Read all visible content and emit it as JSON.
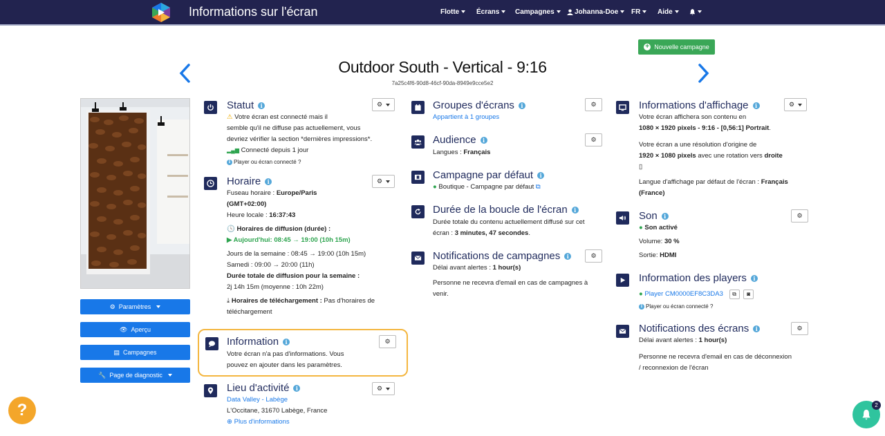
{
  "app": {
    "title": "Informations sur l'écran"
  },
  "nav": {
    "fleet": "Flotte",
    "screens": "Écrans",
    "campaigns": "Campagnes",
    "user": "Johanna-Doe",
    "lang": "FR",
    "help": "Aide"
  },
  "new_campaign": "Nouvelle campagne",
  "screen": {
    "name": "Outdoor South - Vertical - 9:16",
    "uuid": "7a25c4f6-90d8-46cf-90da-8949e9cce5e2"
  },
  "sidebar": {
    "settings": "Paramètres",
    "preview": "Aperçu",
    "campaigns": "Campagnes",
    "diagnostic": "Page de diagnostic"
  },
  "statut": {
    "title": "Statut",
    "msg1": "Votre écran est connecté mais il",
    "msg2": "semble qu'il ne diffuse pas actuellement, vous",
    "msg3": "devriez vérifier la section *dernières impressions*.",
    "connected": "Connecté depuis 1 jour",
    "hint": "Player ou écran connecté ?"
  },
  "horaire": {
    "title": "Horaire",
    "tz_label": "Fuseau horaire :",
    "tz": "Europe/Paris",
    "gmt": "(GMT+02:00)",
    "local_label": "Heure locale :",
    "local": "16:37:43",
    "broadcast": "Horaires de diffusion (durée) :",
    "today": "Aujourd'hui: 08:45 → 19:00 (10h 15m)",
    "weekdays": "Jours de la semaine : 08:45 → 19:00 (10h 15m)",
    "saturday": "Samedi : 09:00 → 20:00 (11h)",
    "total_label": "Durée totale de diffusion pour la semaine :",
    "total": "2j 14h 15m (moyenne : 10h 22m)",
    "download_label": "Horaires de téléchargement :",
    "download1": "Pas d'horaires de",
    "download2": "téléchargement"
  },
  "information": {
    "title": "Information",
    "msg1": "Votre écran n'a pas d'informations. Vous",
    "msg2": "pouvez en ajouter dans les paramètres."
  },
  "lieu": {
    "title": "Lieu d'activité",
    "place": "Data Valley - Labège",
    "address": "L'Occitane, 31670 Labège, France",
    "more": "Plus d'informations"
  },
  "groupes": {
    "title": "Groupes d'écrans",
    "sub": "Appartient à 1 groupes"
  },
  "audience": {
    "title": "Audience",
    "lang_label": "Langues :",
    "lang": "Français"
  },
  "default_campaign": {
    "title": "Campagne par défaut",
    "value": "Boutique - Campagne par défaut"
  },
  "loop": {
    "title": "Durée de la boucle de l'écran",
    "l1": "Durée totale du contenu actuellement diffusé sur cet",
    "l2pre": "écran :",
    "l2": "3 minutes, 47 secondes",
    "l2post": "."
  },
  "notif_campaigns": {
    "title": "Notifications de campagnes",
    "delay_label": "Délai avant alertes :",
    "delay": "1 hour(s)",
    "msg1": "Personne ne recevra d'email en cas de campagnes à",
    "msg2": "venir."
  },
  "display": {
    "title": "Informations d'affichage",
    "l1": "Votre écran affichera son contenu en",
    "l2": "1080 × 1920 pixels - 9:16 - [0,56:1] Portrait",
    "l3": "Votre écran a une résolution d'origine de",
    "l4a": "1920 × 1080 pixels",
    "l4b": "avec une rotation vers",
    "l4c": "droite",
    "l5": "Langue d'affichage par défaut de l'écran :",
    "l5v": "Français",
    "l6": "(France)"
  },
  "son": {
    "title": "Son",
    "active": "Son activé",
    "vol_label": "Volume:",
    "vol": "30 %",
    "out_label": "Sortie:",
    "out": "HDMI"
  },
  "players": {
    "title": "Information des players",
    "player": "Player CM0000EF8C3DA3",
    "hint": "Player ou écran connecté ?"
  },
  "notif_screens": {
    "title": "Notifications des écrans",
    "delay_label": "Délai avant alertes :",
    "delay": "1 hour(s)",
    "msg1": "Personne ne recevra d'email en cas de déconnexion",
    "msg2": "/ reconnexion de l'écran"
  },
  "notifications_count": "2",
  "colors": {
    "navbar": "#22234f",
    "primary": "#1878e8",
    "success": "#3aa757",
    "highlight": "#f4b63f"
  }
}
